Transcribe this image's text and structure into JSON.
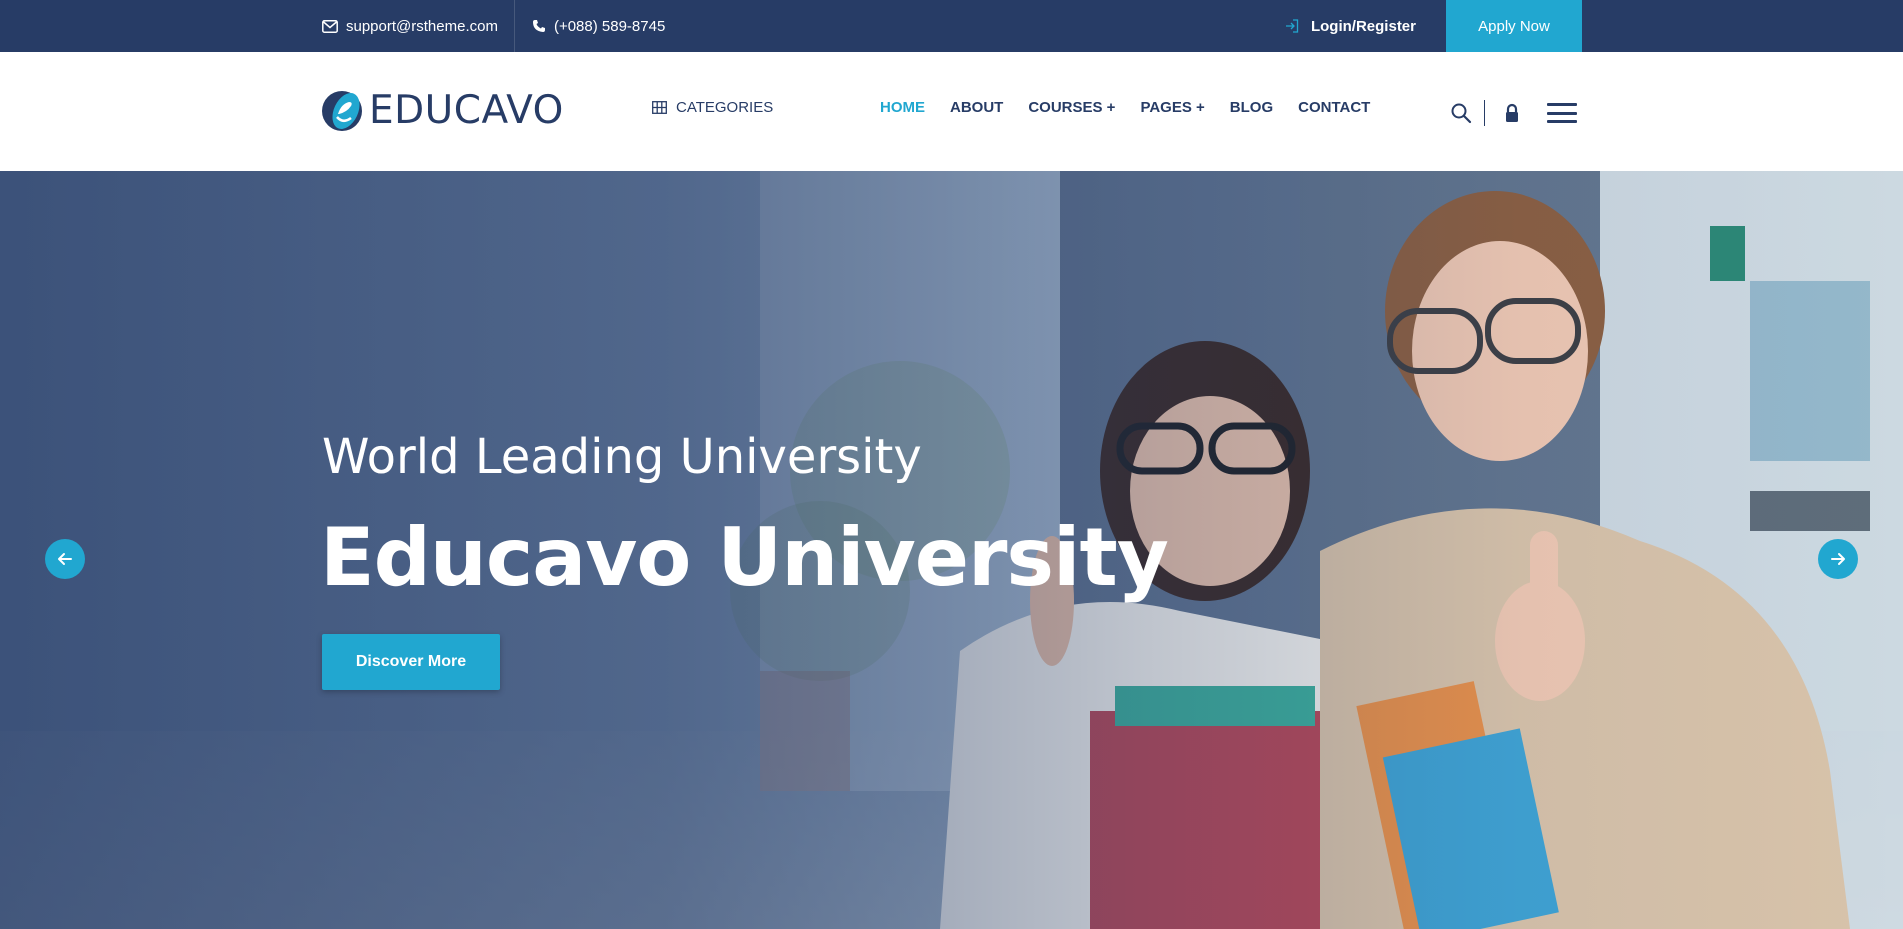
{
  "topbar": {
    "email": "support@rstheme.com",
    "phone": "(+088) 589-8745",
    "login": "Login/Register",
    "apply": "Apply Now"
  },
  "header": {
    "logo_text": "EDUCAVO",
    "categories": "CATEGORIES",
    "nav": [
      {
        "label": "HOME",
        "active": true
      },
      {
        "label": "ABOUT",
        "active": false
      },
      {
        "label": "COURSES +",
        "active": false
      },
      {
        "label": "PAGES +",
        "active": false
      },
      {
        "label": "BLOG",
        "active": false
      },
      {
        "label": "CONTACT",
        "active": false
      }
    ],
    "icons": [
      "search-icon",
      "lock-icon",
      "hamburger-menu-icon"
    ]
  },
  "hero": {
    "subtitle": "World Leading University",
    "title": "Educavo University",
    "button": "Discover More"
  },
  "colors": {
    "navy": "#273c66",
    "accent": "#21a7d0",
    "white": "#ffffff"
  }
}
